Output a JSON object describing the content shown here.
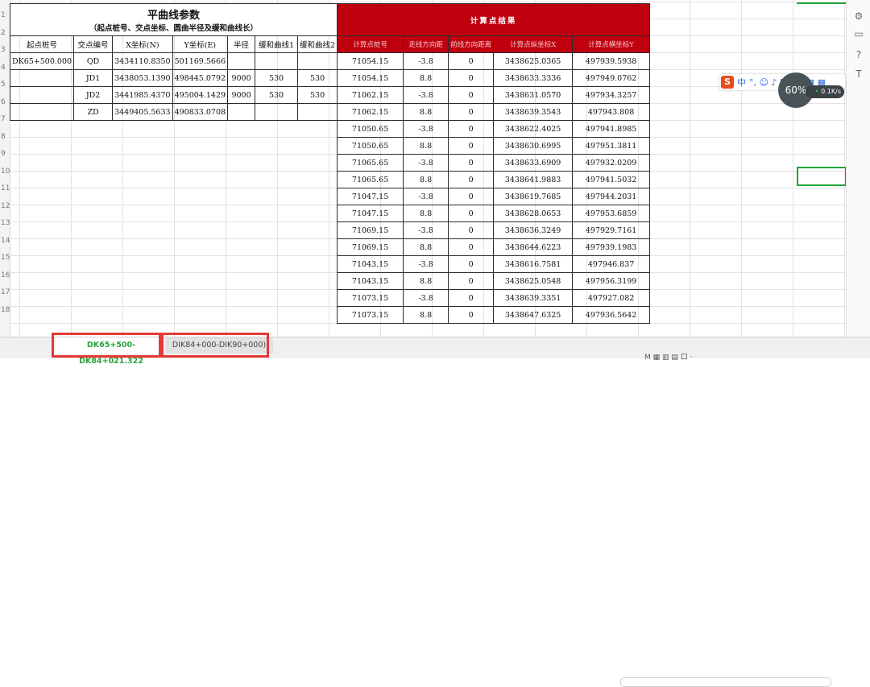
{
  "left_title": "平曲线参数",
  "left_subtitle": "（起点桩号、交点坐标、圆曲半径及缓和曲线长）",
  "right_title": "计算点结果",
  "left_headers": [
    "起点桩号",
    "交点编号",
    "X坐标(N)",
    "Y坐标(E)",
    "半径",
    "缓和曲线1",
    "缓和曲线2"
  ],
  "right_headers": [
    "计算点桩号",
    "走线方向距",
    "前线方向距离",
    "计算点纵坐标X",
    "计算点横坐标Y"
  ],
  "left_rows": [
    [
      "DK65+500.000",
      "QD",
      "3434110.8350",
      "501169.5666",
      "",
      "",
      ""
    ],
    [
      "",
      "JD1",
      "3438053.1390",
      "498445.0792",
      "9000",
      "530",
      "530"
    ],
    [
      "",
      "JD2",
      "3441985.4370",
      "495004.1429",
      "9000",
      "530",
      "530"
    ],
    [
      "",
      "ZD",
      "3449405.5633",
      "490833.0708",
      "",
      "",
      ""
    ]
  ],
  "right_rows": [
    [
      "71054.15",
      "-3.8",
      "0",
      "3438625.0365",
      "497939.5938"
    ],
    [
      "71054.15",
      "8.8",
      "0",
      "3438633.3336",
      "497949.0762"
    ],
    [
      "71062.15",
      "-3.8",
      "0",
      "3438631.0570",
      "497934.3257"
    ],
    [
      "71062.15",
      "8.8",
      "0",
      "3438639.3543",
      "497943.808"
    ],
    [
      "71050.65",
      "-3.8",
      "0",
      "3438622.4025",
      "497941.8985"
    ],
    [
      "71050.65",
      "8.8",
      "0",
      "3438630.6995",
      "497951.3811"
    ],
    [
      "71065.65",
      "-3.8",
      "0",
      "3438633.6909",
      "497932.0209"
    ],
    [
      "71065.65",
      "8.8",
      "0",
      "3438641.9883",
      "497941.5032"
    ],
    [
      "71047.15",
      "-3.8",
      "0",
      "3438619.7685",
      "497944.2031"
    ],
    [
      "71047.15",
      "8.8",
      "0",
      "3438628.0653",
      "497953.6859"
    ],
    [
      "71069.15",
      "-3.8",
      "0",
      "3438636.3249",
      "497929.7161"
    ],
    [
      "71069.15",
      "8.8",
      "0",
      "3438644.6223",
      "497939.1983"
    ],
    [
      "71043.15",
      "-3.8",
      "0",
      "3438616.7581",
      "497946.837"
    ],
    [
      "71043.15",
      "8.8",
      "0",
      "3438625.0548",
      "497956.3199"
    ],
    [
      "71073.15",
      "-3.8",
      "0",
      "3438639.3351",
      "497927.082"
    ],
    [
      "71073.15",
      "8.8",
      "0",
      "3438647.6325",
      "497936.5642"
    ]
  ],
  "row_numbers": [
    "1",
    "2",
    "3",
    "4",
    "5",
    "6",
    "7",
    "8",
    "9",
    "10",
    "11",
    "12",
    "13",
    "14",
    "15",
    "16",
    "17",
    "18"
  ],
  "tabs": [
    "DK65+500-DK84+021.322",
    "DIK84+000-DIK90+000)"
  ],
  "ime": {
    "logo": "S",
    "lang": "中",
    "items": "°, ☺ ♪ ⌨ ♟ ▦ ▦"
  },
  "speed": {
    "percent": "60%",
    "rate": "0.1K/s",
    "unit": "K/s"
  },
  "status_icons": "M ▦ ▥ ▤ 口 ·",
  "colors": {
    "header_red": "#c0000f",
    "selection_green": "#21a336",
    "tab_red_box": "#e53935"
  }
}
